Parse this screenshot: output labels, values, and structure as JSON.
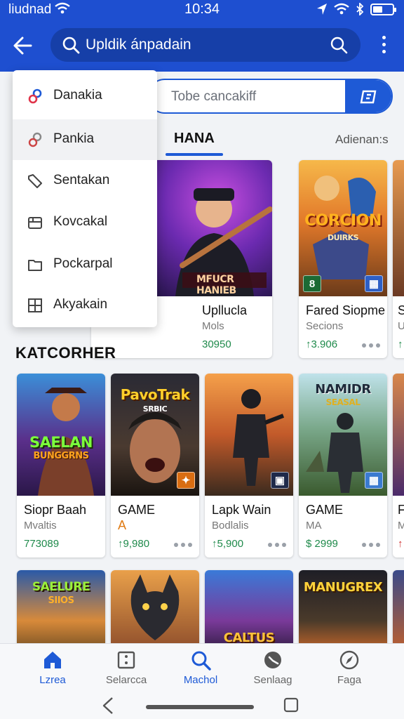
{
  "status_bar": {
    "carrier": "liudnad",
    "time": "10:34"
  },
  "search": {
    "query": "Upldik ánpadain",
    "secondary_placeholder": "Tobe cancakiff"
  },
  "tabs": {
    "active": "HANA",
    "right": "Adienan:s"
  },
  "dropdown": {
    "items": [
      {
        "label": "Danakia",
        "icon": "link-icon"
      },
      {
        "label": "Pankia",
        "icon": "link-icon"
      },
      {
        "label": "Sentakan",
        "icon": "tag-icon"
      },
      {
        "label": "Kovcakal",
        "icon": "inbox-icon"
      },
      {
        "label": "Pockarpal",
        "icon": "folder-icon"
      },
      {
        "label": "Akyakain",
        "icon": "grid-icon"
      }
    ]
  },
  "featured": [
    {
      "art_text": "MFUCR HANIEB",
      "name": "Upllucla",
      "sub": "Mols",
      "price": "30950"
    },
    {
      "art_text": "CORCION",
      "art_sub": "DUIRKS",
      "badge_left": "8",
      "name": "Fared Siopme",
      "sub": "Secions",
      "price": "↑3.906"
    },
    {
      "name": "S",
      "sub": "U",
      "price": "↑"
    }
  ],
  "section_title": "KATCORHER",
  "grid_row1": [
    {
      "art_text": "SAELAN",
      "art_sub": "BUNGGRNS",
      "name": "Siopr Baah",
      "sub": "Mvaltis",
      "price": "773089"
    },
    {
      "art_text": "PavoTrak",
      "art_sub": "SRBIC",
      "name": "GAME",
      "sub": "A",
      "price": "↑9,980"
    },
    {
      "name": "Lapk Wain",
      "sub": "Bodlalis",
      "price": "↑5,900"
    },
    {
      "art_text": "NAMIDR",
      "art_sub": "SEASAL",
      "name": "GAME",
      "sub": "MA",
      "price": "$ 2999"
    },
    {
      "name": "F",
      "sub": "M",
      "price": "↑"
    }
  ],
  "grid_row2": [
    {
      "art_text": "SAELURE",
      "art_sub": "SIIOS"
    },
    {},
    {
      "art_text": "CALTUS"
    },
    {
      "art_text": "MANUGREX"
    },
    {}
  ],
  "bottom_nav": [
    {
      "label": "Lzrea",
      "icon": "home-icon"
    },
    {
      "label": "Selarcca",
      "icon": "square-dot-icon"
    },
    {
      "label": "Machol",
      "icon": "search-icon"
    },
    {
      "label": "Senlaag",
      "icon": "game-icon"
    },
    {
      "label": "Faga",
      "icon": "compass-icon"
    }
  ],
  "colors": {
    "brand_blue": "#1e4fd0",
    "accent_blue": "#1e5ad6",
    "price_green": "#1f8a4b"
  }
}
